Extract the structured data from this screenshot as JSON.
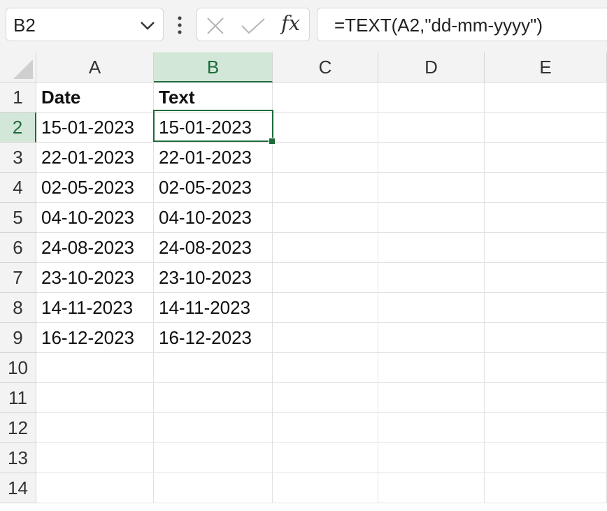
{
  "name_box": {
    "value": "B2"
  },
  "formula_bar": {
    "formula": "=TEXT(A2,\"dd-mm-yyyy\")",
    "fx_label": "fx"
  },
  "columns": [
    "A",
    "B",
    "C",
    "D",
    "E"
  ],
  "rows": [
    "1",
    "2",
    "3",
    "4",
    "5",
    "6",
    "7",
    "8",
    "9",
    "10",
    "11",
    "12",
    "13",
    "14"
  ],
  "selected_cell": {
    "column": "B",
    "row": "2"
  },
  "cells": {
    "header": [
      "Date",
      "Text"
    ],
    "data": [
      [
        "15-01-2023",
        "15-01-2023"
      ],
      [
        "22-01-2023",
        "22-01-2023"
      ],
      [
        "02-05-2023",
        "02-05-2023"
      ],
      [
        "04-10-2023",
        "04-10-2023"
      ],
      [
        "24-08-2023",
        "24-08-2023"
      ],
      [
        "23-10-2023",
        "23-10-2023"
      ],
      [
        "14-11-2023",
        "14-11-2023"
      ],
      [
        "16-12-2023",
        "16-12-2023"
      ]
    ]
  },
  "colors": {
    "accent": "#1e6b3a",
    "header_bg": "#f3f3f3",
    "selected_header_bg": "#d3e7d8",
    "gridline": "#e1e1e1"
  },
  "icons": {
    "name_box_dropdown": "chevron-down-icon",
    "more": "vertical-dots-icon",
    "cancel": "x-icon",
    "enter": "check-icon",
    "insert_function": "fx-icon"
  }
}
